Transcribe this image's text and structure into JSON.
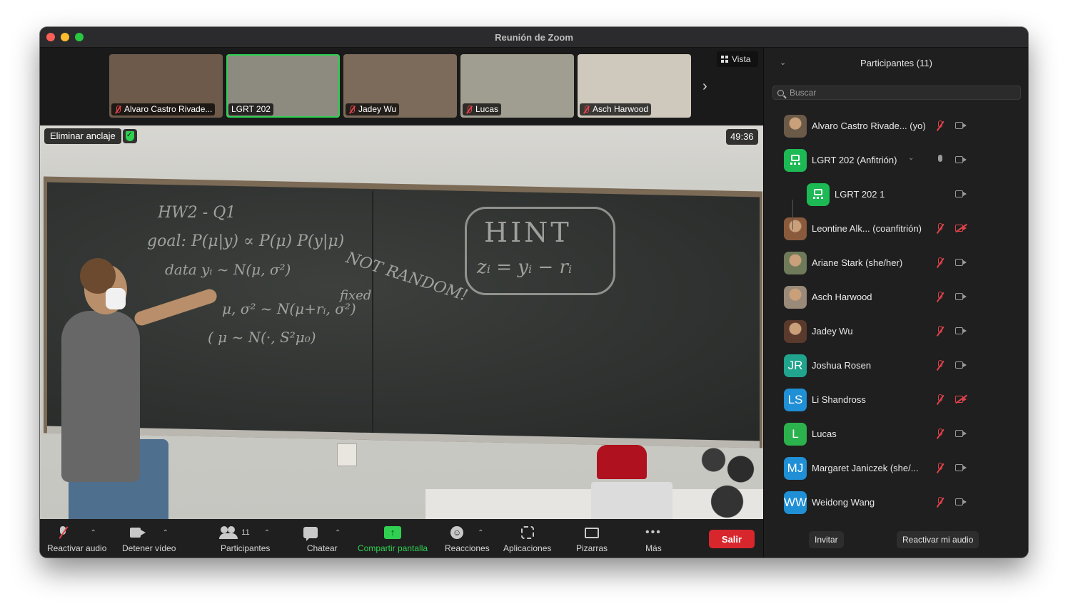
{
  "window": {
    "title": "Reunión de Zoom"
  },
  "strip": {
    "thumbnails": [
      {
        "name": "Alvaro Castro Rivade...",
        "muted": true,
        "active": false,
        "bg": "#6e5a4a"
      },
      {
        "name": "LGRT 202",
        "muted": false,
        "active": true,
        "bg": "#8d8a80"
      },
      {
        "name": "Jadey Wu",
        "muted": true,
        "active": false,
        "bg": "#7c6b5a"
      },
      {
        "name": "Lucas",
        "muted": true,
        "active": false,
        "bg": "#a09e90"
      },
      {
        "name": "Asch Harwood",
        "muted": true,
        "active": false,
        "bg": "#cfc9bd"
      }
    ],
    "view_label": "Vista"
  },
  "video": {
    "unpin_label": "Eliminar anclaje",
    "timer": "49:36"
  },
  "toolbar": {
    "unmute_label": "Reactivar audio",
    "stop_video_label": "Detener vídeo",
    "participants_label": "Participantes",
    "participants_count": "11",
    "chat_label": "Chatear",
    "share_label": "Compartir pantalla",
    "reactions_label": "Reacciones",
    "apps_label": "Aplicaciones",
    "whiteboards_label": "Pizarras",
    "more_label": "Más",
    "leave_label": "Salir"
  },
  "panel": {
    "title": "Participantes (11)",
    "search_placeholder": "Buscar",
    "participants": [
      {
        "name": "Alvaro Castro Rivade...  (yo)",
        "initials": "",
        "avatar_color": "#6b5a48",
        "mic": "off",
        "cam": "on"
      },
      {
        "name": "LGRT 202 (Anfitrión)",
        "initials": "",
        "avatar_color": "#1db954",
        "mic": "on",
        "cam": "on",
        "room": true
      },
      {
        "name": "LGRT 202 1",
        "initials": "",
        "avatar_color": "#1db954",
        "mic": "none",
        "cam": "on",
        "room": true,
        "child": true
      },
      {
        "name": "Leontine Alk...  (coanfitrión)",
        "initials": "",
        "avatar_color": "#8a5a3c",
        "mic": "off",
        "cam": "off"
      },
      {
        "name": "Ariane Stark (she/her)",
        "initials": "",
        "avatar_color": "#6f7a5a",
        "mic": "off",
        "cam": "on"
      },
      {
        "name": "Asch Harwood",
        "initials": "",
        "avatar_color": "#9a8a7a",
        "mic": "off",
        "cam": "on"
      },
      {
        "name": "Jadey Wu",
        "initials": "",
        "avatar_color": "#5a3a2c",
        "mic": "off",
        "cam": "on"
      },
      {
        "name": "Joshua Rosen",
        "initials": "JR",
        "avatar_color": "#21a48e",
        "mic": "off",
        "cam": "on"
      },
      {
        "name": "Li Shandross",
        "initials": "LS",
        "avatar_color": "#1f8fd6",
        "mic": "off",
        "cam": "off"
      },
      {
        "name": "Lucas",
        "initials": "L",
        "avatar_color": "#2bb24c",
        "mic": "off",
        "cam": "on"
      },
      {
        "name": "Margaret Janiczek (she/...",
        "initials": "MJ",
        "avatar_color": "#1f8fd6",
        "mic": "off",
        "cam": "on"
      },
      {
        "name": "Weidong Wang",
        "initials": "WW",
        "avatar_color": "#1f8fd6",
        "mic": "off",
        "cam": "on"
      }
    ],
    "invite_label": "Invitar",
    "unmute_me_label": "Reactivar mi audio"
  }
}
